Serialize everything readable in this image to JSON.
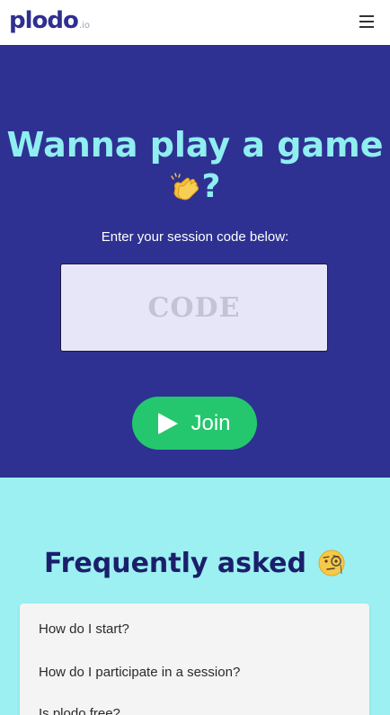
{
  "navbar": {
    "logo_main": "plodo",
    "logo_sub": ".io",
    "menu_icon": "hamburger-menu-icon"
  },
  "hero": {
    "title_line1": "Wanna play a game",
    "title_line2_suffix": "?",
    "title_icon": "clapping-hands-icon",
    "session_label": "Enter your session code below:",
    "code_placeholder": "CODE",
    "code_value": "",
    "join_label": "Join",
    "join_icon": "play-icon",
    "colors": {
      "background": "#2e3192",
      "title": "#8feef0",
      "join_button": "#24c76d",
      "input_bg": "#e7e6f8"
    }
  },
  "faq": {
    "title": "Frequently asked",
    "title_icon": "monocle-face-icon",
    "items": [
      "How do I start?",
      "How do I participate in a session?",
      "Is plodo free?"
    ],
    "colors": {
      "background": "#9cf0f1",
      "title": "#1b1f6b"
    }
  }
}
